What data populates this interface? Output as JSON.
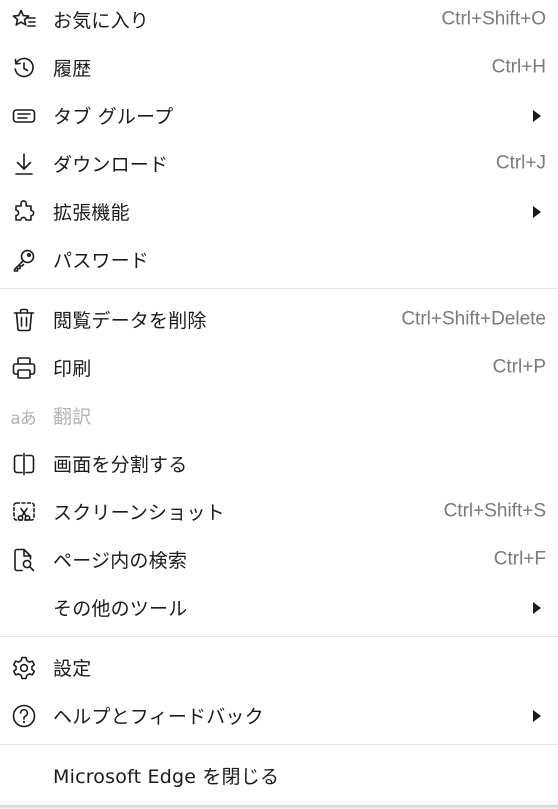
{
  "menu": {
    "items": [
      {
        "label": "お気に入り",
        "shortcut": "Ctrl+Shift+O",
        "icon": "favorites-icon"
      },
      {
        "label": "履歴",
        "shortcut": "Ctrl+H",
        "icon": "history-icon"
      },
      {
        "label": "タブ グループ",
        "shortcut": "",
        "icon": "tab-groups-icon",
        "submenu": true
      },
      {
        "label": "ダウンロード",
        "shortcut": "Ctrl+J",
        "icon": "download-icon"
      },
      {
        "label": "拡張機能",
        "shortcut": "",
        "icon": "extensions-icon",
        "submenu": true
      },
      {
        "label": "パスワード",
        "shortcut": "",
        "icon": "key-icon"
      },
      {
        "label": "閲覧データを削除",
        "shortcut": "Ctrl+Shift+Delete",
        "icon": "trash-icon"
      },
      {
        "label": "印刷",
        "shortcut": "Ctrl+P",
        "icon": "printer-icon"
      },
      {
        "label": "翻訳",
        "shortcut": "",
        "icon": "translate-icon",
        "disabled": true,
        "icon_text": "aあ"
      },
      {
        "label": "画面を分割する",
        "shortcut": "",
        "icon": "split-screen-icon"
      },
      {
        "label": "スクリーンショット",
        "shortcut": "Ctrl+Shift+S",
        "icon": "screenshot-icon"
      },
      {
        "label": "ページ内の検索",
        "shortcut": "Ctrl+F",
        "icon": "find-on-page-icon"
      },
      {
        "label": "その他のツール",
        "shortcut": "",
        "icon": "",
        "submenu": true
      },
      {
        "label": "設定",
        "shortcut": "",
        "icon": "gear-icon"
      },
      {
        "label": "ヘルプとフィードバック",
        "shortcut": "",
        "icon": "help-icon",
        "submenu": true
      },
      {
        "label": "Microsoft Edge を閉じる",
        "shortcut": "",
        "icon": ""
      }
    ]
  },
  "colors": {
    "text": "#1b1b1b",
    "shortcut": "#7a7a7a",
    "disabled": "#b3b3b3",
    "divider": "#e5e5e5",
    "background": "#ffffff"
  }
}
